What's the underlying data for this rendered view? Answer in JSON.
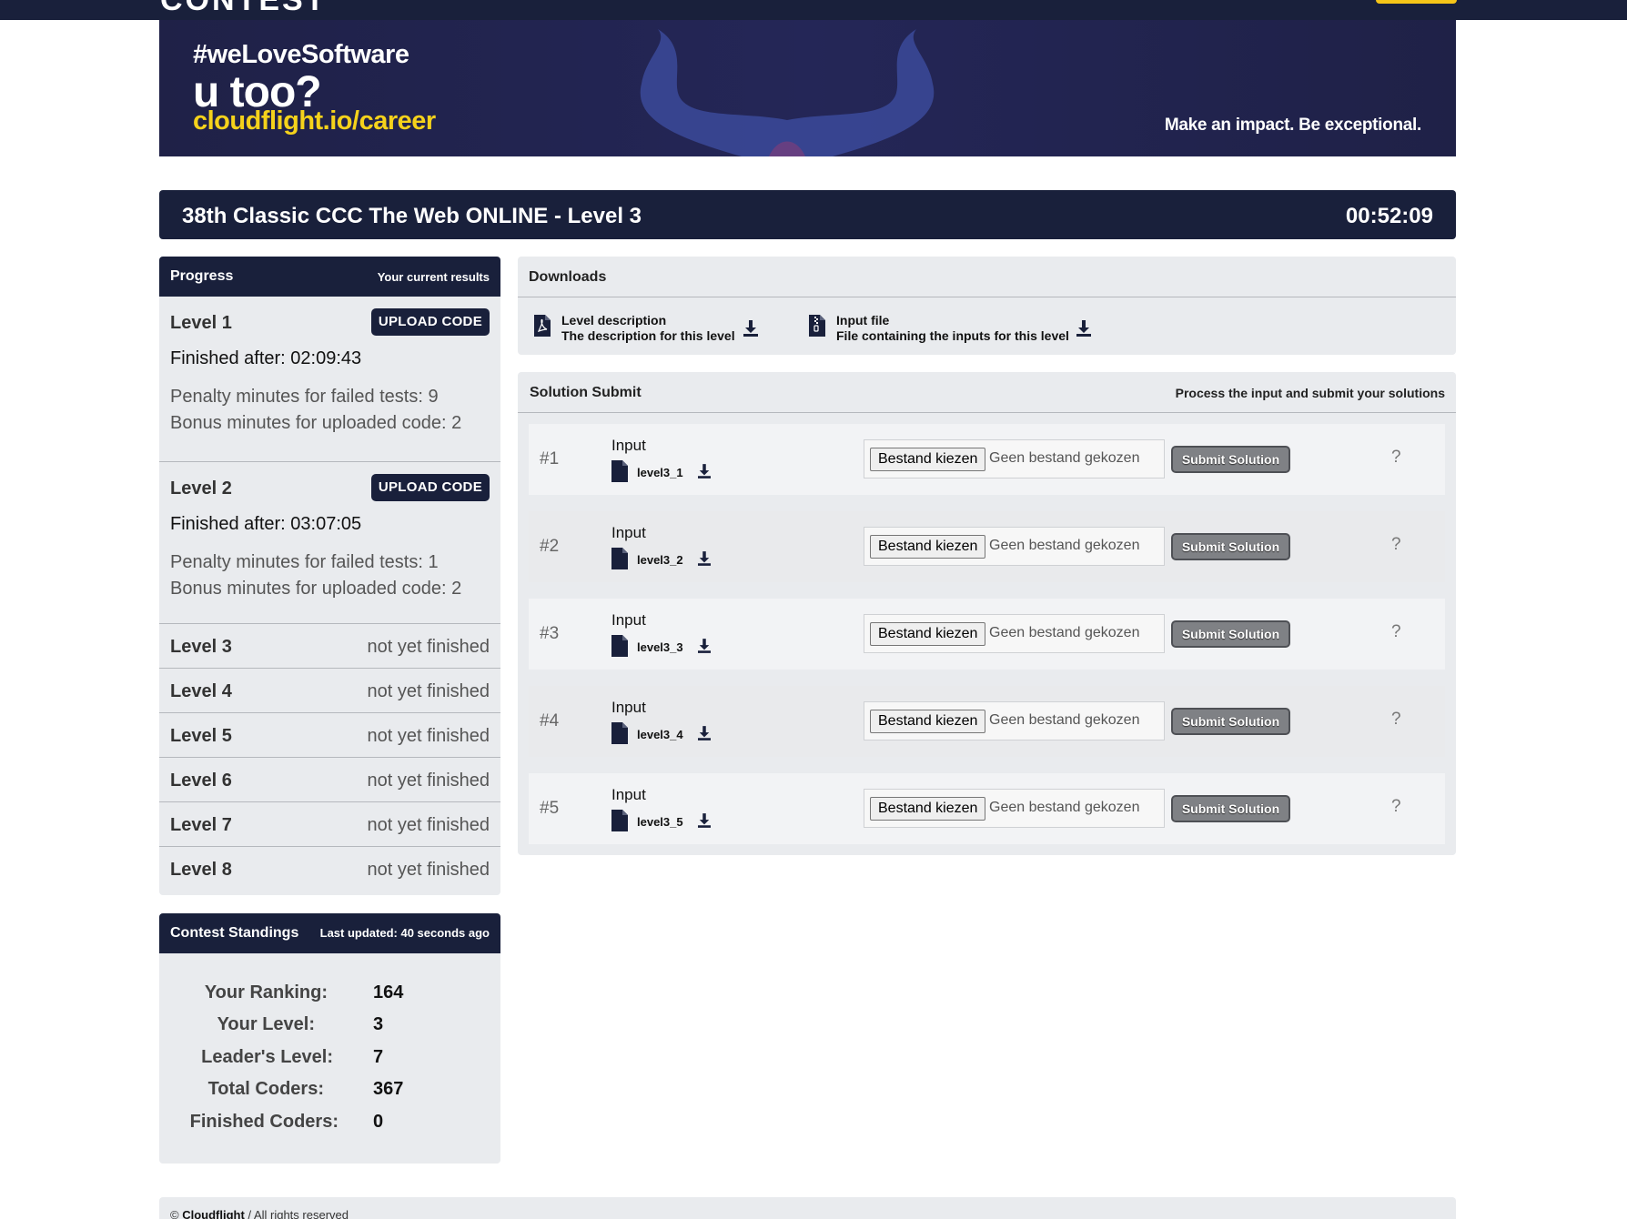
{
  "topbar": {
    "logo": "CONTEST"
  },
  "banner": {
    "hashtag": "#weLoveSoftware",
    "question": "u too?",
    "url": "cloudflight.io/career",
    "slogan": "Make an impact. Be exceptional."
  },
  "title": {
    "text": "38th Classic CCC The Web ONLINE - Level 3",
    "timer": "00:52:09"
  },
  "progress": {
    "heading": "Progress",
    "subheading": "Your current results",
    "finished_levels": [
      {
        "name": "Level 1",
        "upload_label": "UPLOAD CODE",
        "finished": "Finished after: 02:09:43",
        "penalty": "Penalty minutes for failed tests: 9",
        "bonus": "Bonus minutes for uploaded code: 2"
      },
      {
        "name": "Level 2",
        "upload_label": "UPLOAD CODE",
        "finished": "Finished after: 03:07:05",
        "penalty": "Penalty minutes for failed tests: 1",
        "bonus": "Bonus minutes for uploaded code: 2"
      }
    ],
    "pending_levels": [
      {
        "name": "Level 3",
        "status": "not yet finished"
      },
      {
        "name": "Level 4",
        "status": "not yet finished"
      },
      {
        "name": "Level 5",
        "status": "not yet finished"
      },
      {
        "name": "Level 6",
        "status": "not yet finished"
      },
      {
        "name": "Level 7",
        "status": "not yet finished"
      },
      {
        "name": "Level 8",
        "status": "not yet finished"
      }
    ]
  },
  "standings": {
    "heading": "Contest Standings",
    "updated": "Last updated: 40 seconds ago",
    "rows": [
      {
        "label": "Your Ranking:",
        "value": "164"
      },
      {
        "label": "Your Level:",
        "value": "3"
      },
      {
        "label": "Leader's Level:",
        "value": "7"
      },
      {
        "label": "Total Coders:",
        "value": "367"
      },
      {
        "label": "Finished Coders:",
        "value": "0"
      }
    ]
  },
  "downloads": {
    "heading": "Downloads",
    "items": [
      {
        "title": "Level description",
        "subtitle": "The description for this level",
        "icon": "pdf-file-icon"
      },
      {
        "title": "Input file",
        "subtitle": "File containing the inputs for this level",
        "icon": "zip-file-icon"
      }
    ]
  },
  "solution": {
    "heading": "Solution Submit",
    "subheading": "Process the input and submit your solutions",
    "input_label": "Input",
    "choose_label": "Bestand kiezen",
    "no_file_label": "Geen bestand gekozen",
    "submit_label": "Submit Solution",
    "help_label": "?",
    "rows": [
      {
        "num": "#1",
        "file": "level3_1"
      },
      {
        "num": "#2",
        "file": "level3_2"
      },
      {
        "num": "#3",
        "file": "level3_3"
      },
      {
        "num": "#4",
        "file": "level3_4"
      },
      {
        "num": "#5",
        "file": "level3_5"
      }
    ]
  },
  "footer": {
    "copyright": "©",
    "company": "Cloudflight",
    "rights": "/ All rights reserved"
  },
  "colors": {
    "navy": "#19203b",
    "panel": "#e9ebee",
    "accent_yellow": "#f5d21b",
    "submit_gray": "#7f8185"
  }
}
